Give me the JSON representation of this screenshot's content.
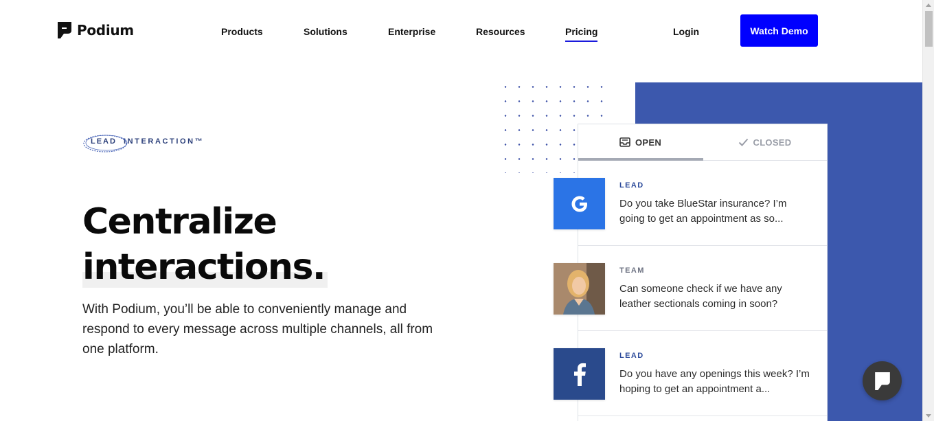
{
  "header": {
    "logo_text": "Podium",
    "nav": [
      {
        "label": "Products"
      },
      {
        "label": "Solutions"
      },
      {
        "label": "Enterprise"
      },
      {
        "label": "Resources"
      },
      {
        "label": "Pricing"
      }
    ],
    "active_nav": "Pricing",
    "login_label": "Login",
    "cta_label": "Watch Demo"
  },
  "hero": {
    "badge_lead": "LEAD",
    "badge_rest": "INTERACTION™",
    "headline_line1": "Centralize",
    "headline_line2": "interactions.",
    "lede": "With Podium, you’ll be able to conveniently manage and respond to every message across multiple channels, all from one platform."
  },
  "inbox": {
    "tab_open": "OPEN",
    "tab_closed": "CLOSED",
    "messages": [
      {
        "channel": "google",
        "glyph": "G",
        "tag": "LEAD",
        "text": "Do you take BlueStar insurance? I’m going to get an appointment as so..."
      },
      {
        "channel": "photo",
        "glyph": "",
        "tag": "TEAM",
        "text": "Can someone check if we have any leather sectionals coming in soon?"
      },
      {
        "channel": "facebook",
        "glyph": "f",
        "tag": "LEAD",
        "text": "Do you have any openings this week? I’m hoping to get an appointment a..."
      }
    ]
  },
  "colors": {
    "cta": "#0000ff",
    "panel": "#3c58ad",
    "google": "#2b74e6",
    "facebook": "#2a4a8c",
    "chat": "#3a3a3a"
  }
}
